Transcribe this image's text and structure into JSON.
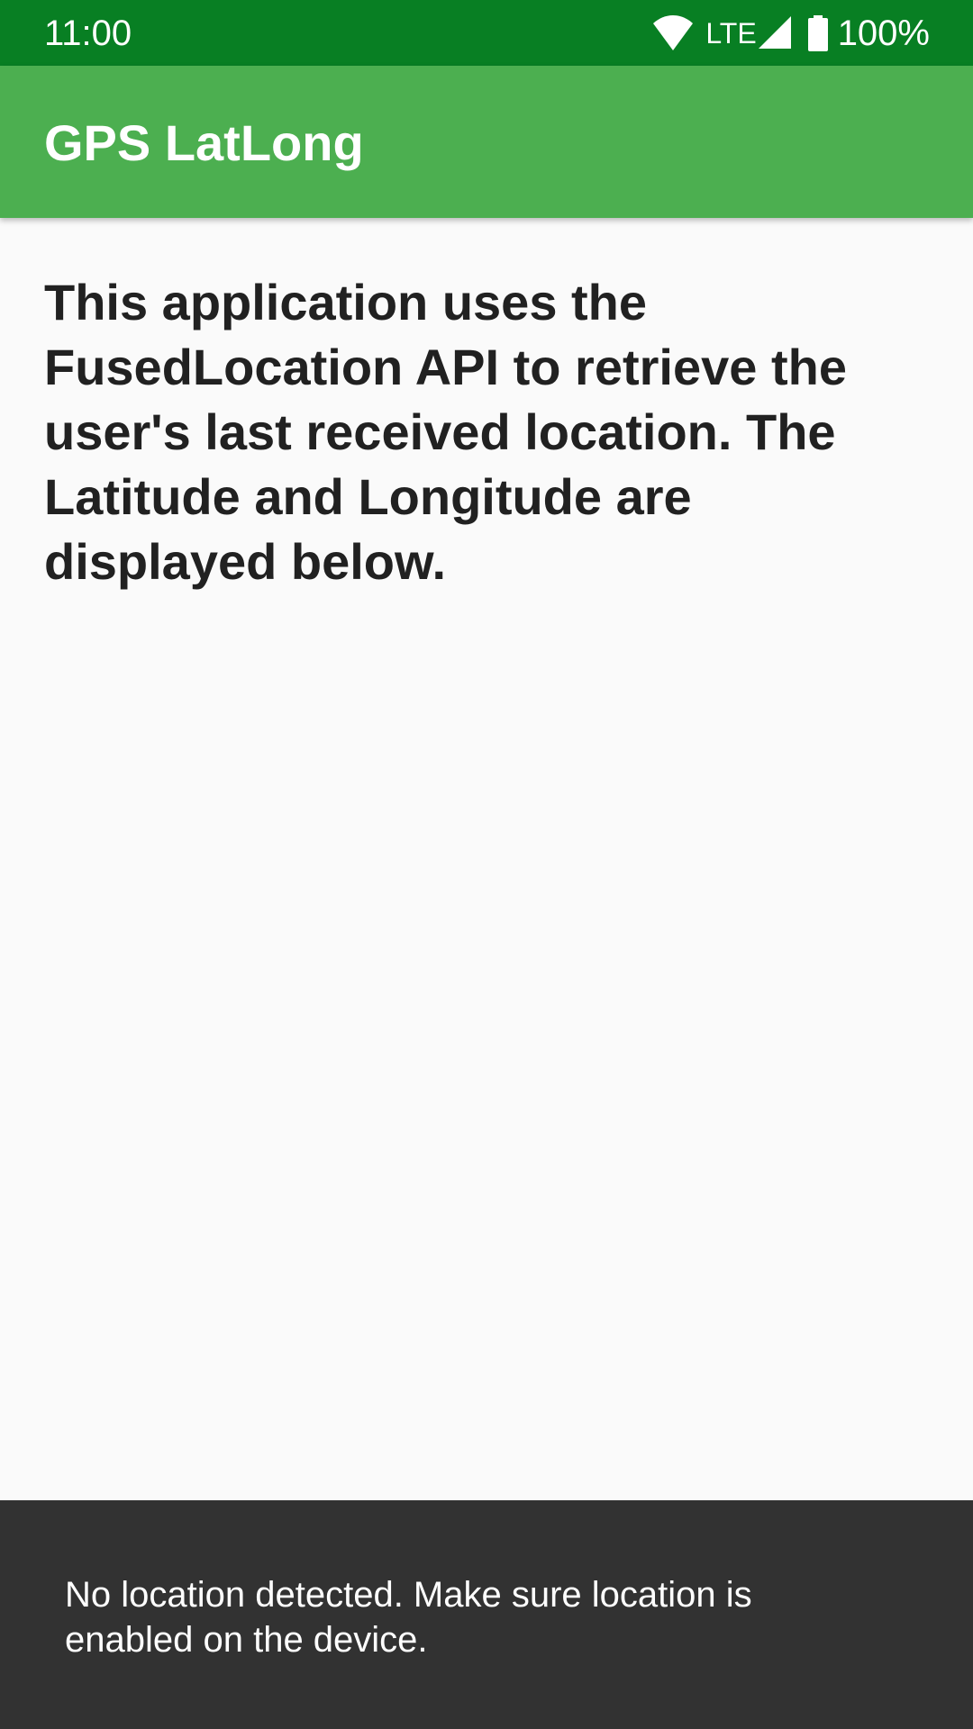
{
  "status_bar": {
    "time": "11:00",
    "network_label": "LTE",
    "battery_percent": "100%",
    "icons": [
      "wifi-icon",
      "signal-icon",
      "battery-icon"
    ]
  },
  "app_bar": {
    "title": "GPS LatLong"
  },
  "main": {
    "description": "This application uses the FusedLocation API to retrieve the user's last received location. The Latitude and Longitude are displayed below."
  },
  "snackbar": {
    "message": "No location detected. Make sure location is enabled on the device."
  },
  "colors": {
    "status_bar": "#087f23",
    "app_bar": "#4caf50",
    "background": "#fafafa",
    "snackbar": "#323232",
    "text_primary": "#212121"
  }
}
